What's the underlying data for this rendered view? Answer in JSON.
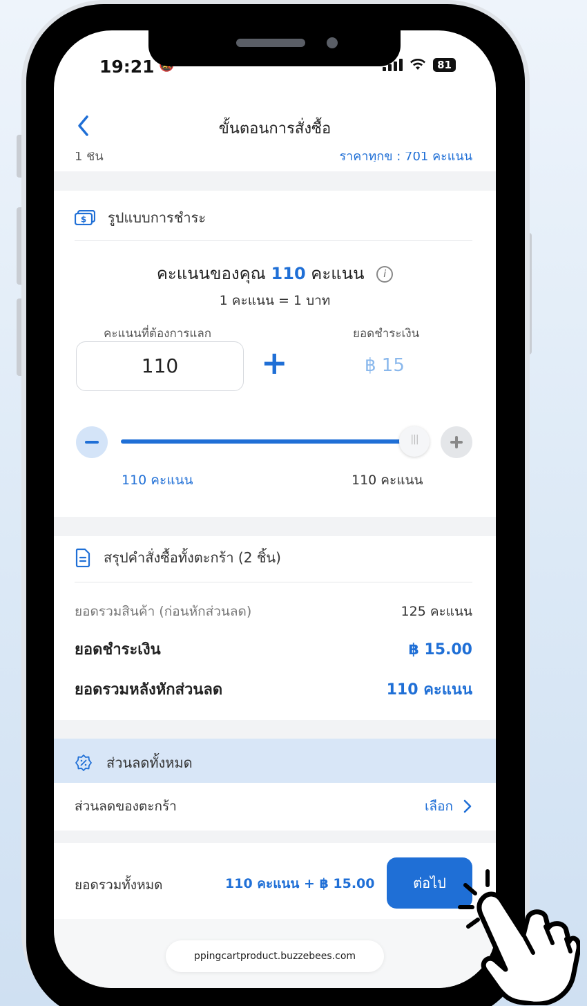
{
  "status": {
    "time": "19:21",
    "battery": "81"
  },
  "header": {
    "title": "ขั้นตอนการสั่งซื้อ",
    "back_icon": "chevron-left-icon"
  },
  "cut_row": {
    "left": "1 ชิ้น",
    "right": "ราคาทุกข : 701 คะแนน"
  },
  "payment": {
    "section_title": "รูปแบบการชำระ",
    "points_prefix": "คะแนนของคุณ",
    "points_value": "110",
    "points_unit": "คะแนน",
    "rate": "1 คะแนน = 1 บาท",
    "exchange_label": "คะแนนที่ต้องการแลก",
    "exchange_value": "110",
    "pay_label": "ยอดชำระเงิน",
    "pay_value": "฿ 15",
    "slider_min": "110 คะแนน",
    "slider_max": "110 คะแนน",
    "slider_fraction": 1.0
  },
  "summary": {
    "title": "สรุปคำสั่งซื้อทั้งตะกร้า (2 ชิ้น)",
    "rows": [
      {
        "label": "ยอดรวมสินค้า (ก่อนหักส่วนลด)",
        "value": "125 คะแนน"
      },
      {
        "label": "ยอดชำระเงิน",
        "value": "฿ 15.00"
      },
      {
        "label": "ยอดรวมหลังหักส่วนลด",
        "value": "110 คะแนน"
      }
    ]
  },
  "discounts": {
    "title": "ส่วนลดทั้งหมด",
    "cart_discount_label": "ส่วนลดของตะกร้า",
    "select_label": "เลือก"
  },
  "footer": {
    "total_label": "ยอดรวมทั้งหมด",
    "total_value": "110 คะแนน + ฿ 15.00",
    "next_label": "ต่อไป"
  },
  "url": "ppingcartproduct.buzzebees.com",
  "colors": {
    "accent": "#1f6fd6",
    "band": "#d8e6f7",
    "pay_light": "#8ab8ec"
  }
}
